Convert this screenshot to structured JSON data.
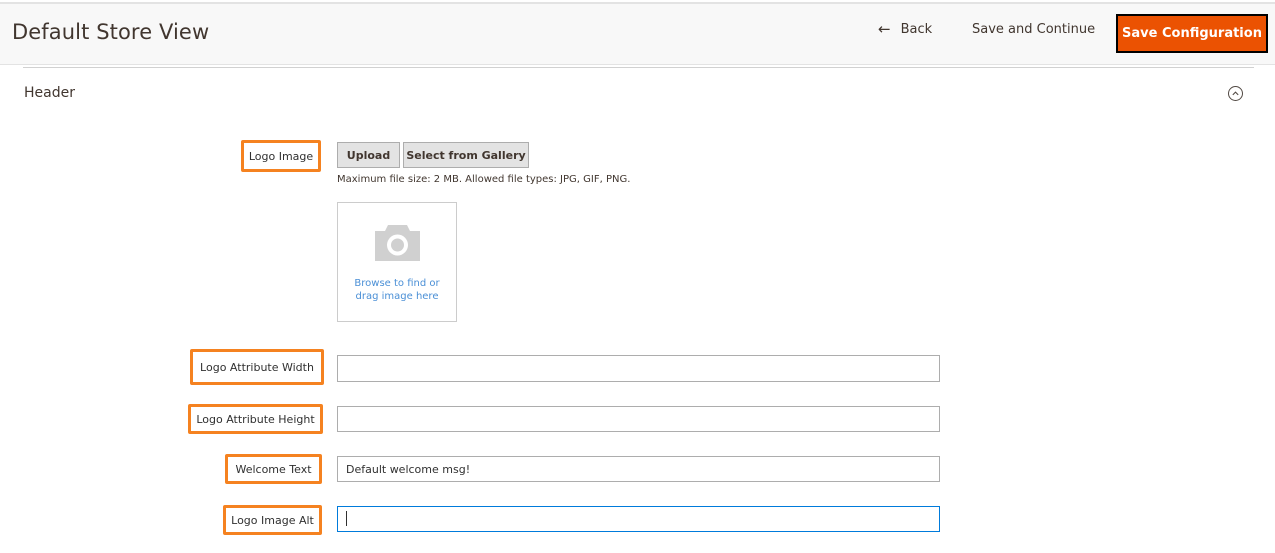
{
  "header": {
    "title": "Default Store View",
    "back_label": "Back",
    "back_icon": "arrow-left-icon",
    "save_continue_label": "Save and Continue",
    "save_config_label": "Save Configuration"
  },
  "section": {
    "title": "Header",
    "collapse_icon": "chevron-up-circle-icon"
  },
  "fields": {
    "logo_image": {
      "label": "Logo Image",
      "upload_label": "Upload",
      "gallery_label": "Select from Gallery",
      "hint": "Maximum file size: 2 MB. Allowed file types: JPG, GIF, PNG.",
      "dropzone_icon": "camera-icon",
      "dropzone_line1": "Browse to find or",
      "dropzone_line2": "drag image here"
    },
    "logo_width": {
      "label": "Logo Attribute Width",
      "value": ""
    },
    "logo_height": {
      "label": "Logo Attribute Height",
      "value": ""
    },
    "welcome_text": {
      "label": "Welcome Text",
      "value": "Default welcome msg!"
    },
    "logo_alt": {
      "label": "Logo Image Alt",
      "value": ""
    }
  },
  "colors": {
    "primary_button": "#eb5202",
    "highlight_border": "#f58220",
    "focus_border": "#007bdb",
    "link": "#4a8fd6"
  }
}
